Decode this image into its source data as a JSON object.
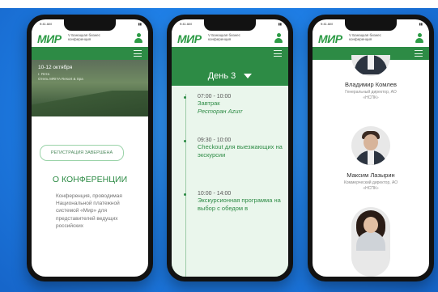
{
  "status": {
    "time": "9:41 AM"
  },
  "brand": {
    "logo": "МИР",
    "tagline": "V Банацкая бизнес конференция"
  },
  "phone1": {
    "dates": "10-12 октября",
    "city": "г. Ялта",
    "hotel": "Отель MRIYA Resort & Spa",
    "register_button": "РЕГИСТРАЦИЯ ЗАВЕРШЕНА",
    "about_title": "О КОНФЕРЕНЦИИ",
    "about_text": "Конференция, проводимая Национальной платежной системой «Мир» для представителей ведущих российских"
  },
  "phone2": {
    "day_label": "День 3",
    "events": [
      {
        "time": "07:00 - 10:00",
        "name": "Завтрак",
        "place": "Ресторан Azurr"
      },
      {
        "time": "09:30 - 10:00",
        "name": "Checkout для выезжающих на экскурсии",
        "place": ""
      },
      {
        "time": "10:00 - 14:00",
        "name": "Экскурсионная программа на выбор с обедом в",
        "place": ""
      }
    ]
  },
  "phone3": {
    "speakers": [
      {
        "name": "Владимир Комлев",
        "position": "Генеральный директор, АО «НСПК»"
      },
      {
        "name": "Максим Лазырин",
        "position": "Коммерческий директор, АО «НСПК»"
      }
    ]
  },
  "colors": {
    "brand_green": "#2d8b45",
    "background_blue": "#1f7fe6"
  }
}
